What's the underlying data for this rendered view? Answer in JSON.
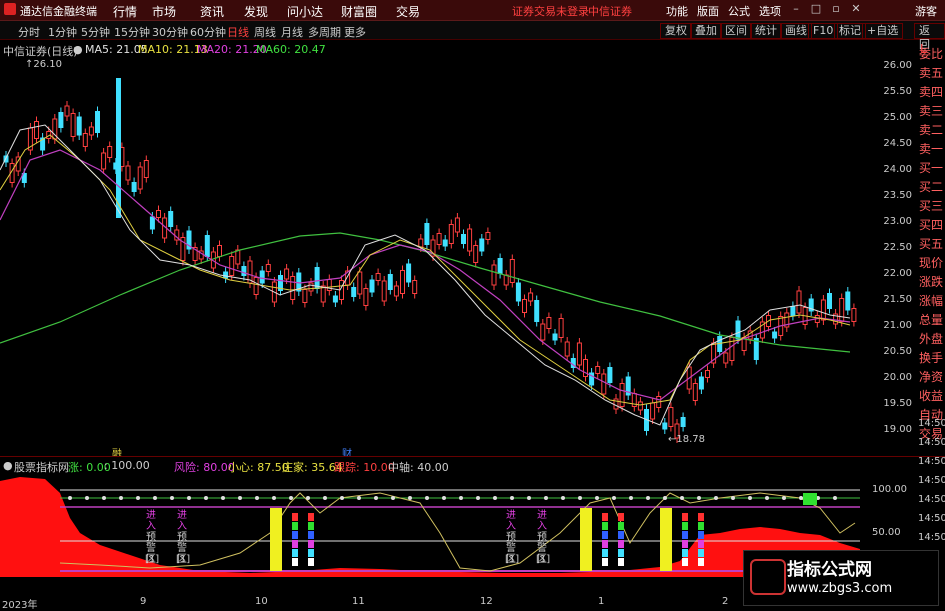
{
  "app": {
    "title": "通达信金融终端"
  },
  "menu": {
    "items": [
      "行情",
      "市场",
      "资讯",
      "发现",
      "问小达",
      "财富圈",
      "交易"
    ],
    "warning": "证券交易未登录",
    "broker": "中信证券",
    "right_items": [
      "功能",
      "版面",
      "公式",
      "选项"
    ],
    "guest": "游客"
  },
  "periods": {
    "items": [
      "分时",
      "1分钟",
      "5分钟",
      "15分钟",
      "30分钟",
      "60分钟",
      "日线",
      "周线",
      "月线",
      "多周期",
      "更多"
    ],
    "active": "日线"
  },
  "toolbar": {
    "items": [
      "复权",
      "叠加",
      "区间",
      "统计",
      "画线",
      "F10",
      "标记",
      "+自选",
      "返回"
    ]
  },
  "main": {
    "stock": "中信证券(日线)",
    "ma": [
      {
        "label": "MA5: 21.05",
        "color": "#e0e0e0"
      },
      {
        "label": "MA10: 21.13",
        "color": "#e8e040"
      },
      {
        "label": "MA20: 21.20",
        "color": "#e040e0"
      },
      {
        "label": "MA60: 20.47",
        "color": "#40e040"
      }
    ],
    "high_label": "26.10",
    "low_label": "18.78",
    "price_labels": [
      "26.00",
      "25.50",
      "25.00",
      "24.50",
      "24.00",
      "23.50",
      "23.00",
      "22.50",
      "22.00",
      "21.50",
      "21.00",
      "20.50",
      "20.00",
      "19.50",
      "19.00"
    ],
    "side_panel": [
      "委比",
      "卖五",
      "卖四",
      "卖三",
      "卖二",
      "卖一",
      "买一",
      "买二",
      "买三",
      "买四",
      "买五",
      "现价",
      "涨跌",
      "涨幅",
      "总量",
      "外盘",
      "换手",
      "净资",
      "收益",
      "自动",
      "交易"
    ],
    "bottom_markers": [
      "融",
      "财"
    ],
    "tag": "L"
  },
  "indicator": {
    "name": "股票指标网",
    "items": [
      {
        "label": "涨: 0.00",
        "color": "#40e040"
      },
      {
        "label": ": 100.00",
        "color": "#ccc"
      },
      {
        "label": "风险: 80.00",
        "color": "#e040e0"
      },
      {
        "label": "小心: 87.50",
        "color": "#e8e040"
      },
      {
        "label": "庄家: 35.64",
        "color": "#e8e040"
      },
      {
        "label": "跟踪: 10.00",
        "color": "#ff4040"
      },
      {
        "label": "中轴: 40.00",
        "color": "#ccc"
      }
    ],
    "levels": [
      "100.00",
      "50.00"
    ],
    "labels": [
      "进",
      "入",
      "预",
      "警[1]",
      "区"
    ]
  },
  "time_axis": {
    "labels": [
      "2023年",
      "9",
      "10",
      "11",
      "12",
      "1",
      "2"
    ]
  },
  "time_right": [
    "14:50",
    "14:50",
    "14:50",
    "14:50",
    "14:50",
    "14:50",
    "14:50"
  ],
  "watermark": {
    "title": "指标公式网",
    "url": "www.zbgs3.com"
  }
}
